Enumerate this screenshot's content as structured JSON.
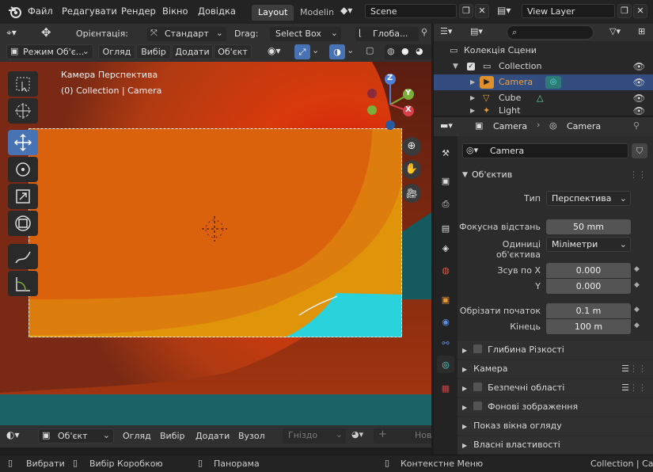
{
  "topbar": {
    "menus": [
      "Файл",
      "Редагувати",
      "Рендер",
      "Вікно",
      "Довідка"
    ],
    "tabs": [
      "Layout",
      "Modeling"
    ],
    "scene": "Scene",
    "view_layer": "View Layer"
  },
  "viewport_header": {
    "orientation_label": "Орієнтація:",
    "orientation_value": "Стандарт",
    "drag_label": "Drag:",
    "drag_value": "Select Box",
    "transform_value": "Глоба...",
    "mode": "Режим Об'є...",
    "menus": [
      "Огляд",
      "Вибір",
      "Додати",
      "Об'єкт"
    ]
  },
  "viewport": {
    "overlay_line1": "Камера Перспектива",
    "overlay_line2": "(0) Collection | Camera",
    "gizmo_axes": [
      "Z",
      "Y",
      "X"
    ]
  },
  "bottom_header": {
    "mode": "Об'єкт",
    "menus": [
      "Огляд",
      "Вибір",
      "Додати",
      "Вузол"
    ],
    "slot": "Гніздо",
    "new": "Нов"
  },
  "statusbar": {
    "items": [
      "Вибрати",
      "Вибір Коробкою",
      "Панорама",
      "Контекстне Меню"
    ],
    "right": "Collection | Cam"
  },
  "outliner": {
    "root": "Колекція Сцени",
    "collection": "Collection",
    "items": [
      "Camera",
      "Cube",
      "Light"
    ]
  },
  "properties": {
    "breadcrumb_object": "Camera",
    "breadcrumb_data": "Camera",
    "data_name": "Camera",
    "lens_panel": "Об'єктив",
    "type_label": "Тип",
    "type_value": "Перспектива",
    "focal_label": "Фокусна відстань",
    "focal_value": "50 mm",
    "units_label": "Одиниці об'єктива",
    "units_value": "Міліметри",
    "shift_x_label": "Зсув по X",
    "shift_x_value": "0.000",
    "shift_y_label": "Y",
    "shift_y_value": "0.000",
    "clip_start_label": "Обрізати початок",
    "clip_start_value": "0.1 m",
    "clip_end_label": "Кінець",
    "clip_end_value": "100 m",
    "panels": [
      "Глибина Різкості",
      "Камера",
      "Безпечні області",
      "Фонові зображення",
      "Показ вікна огляду",
      "Власні властивості"
    ]
  },
  "colors": {
    "accent": "#4772b3",
    "selected_row": "#334d80",
    "camera_orange": "#f0a030",
    "sky_teal": "#2ad3dc"
  }
}
